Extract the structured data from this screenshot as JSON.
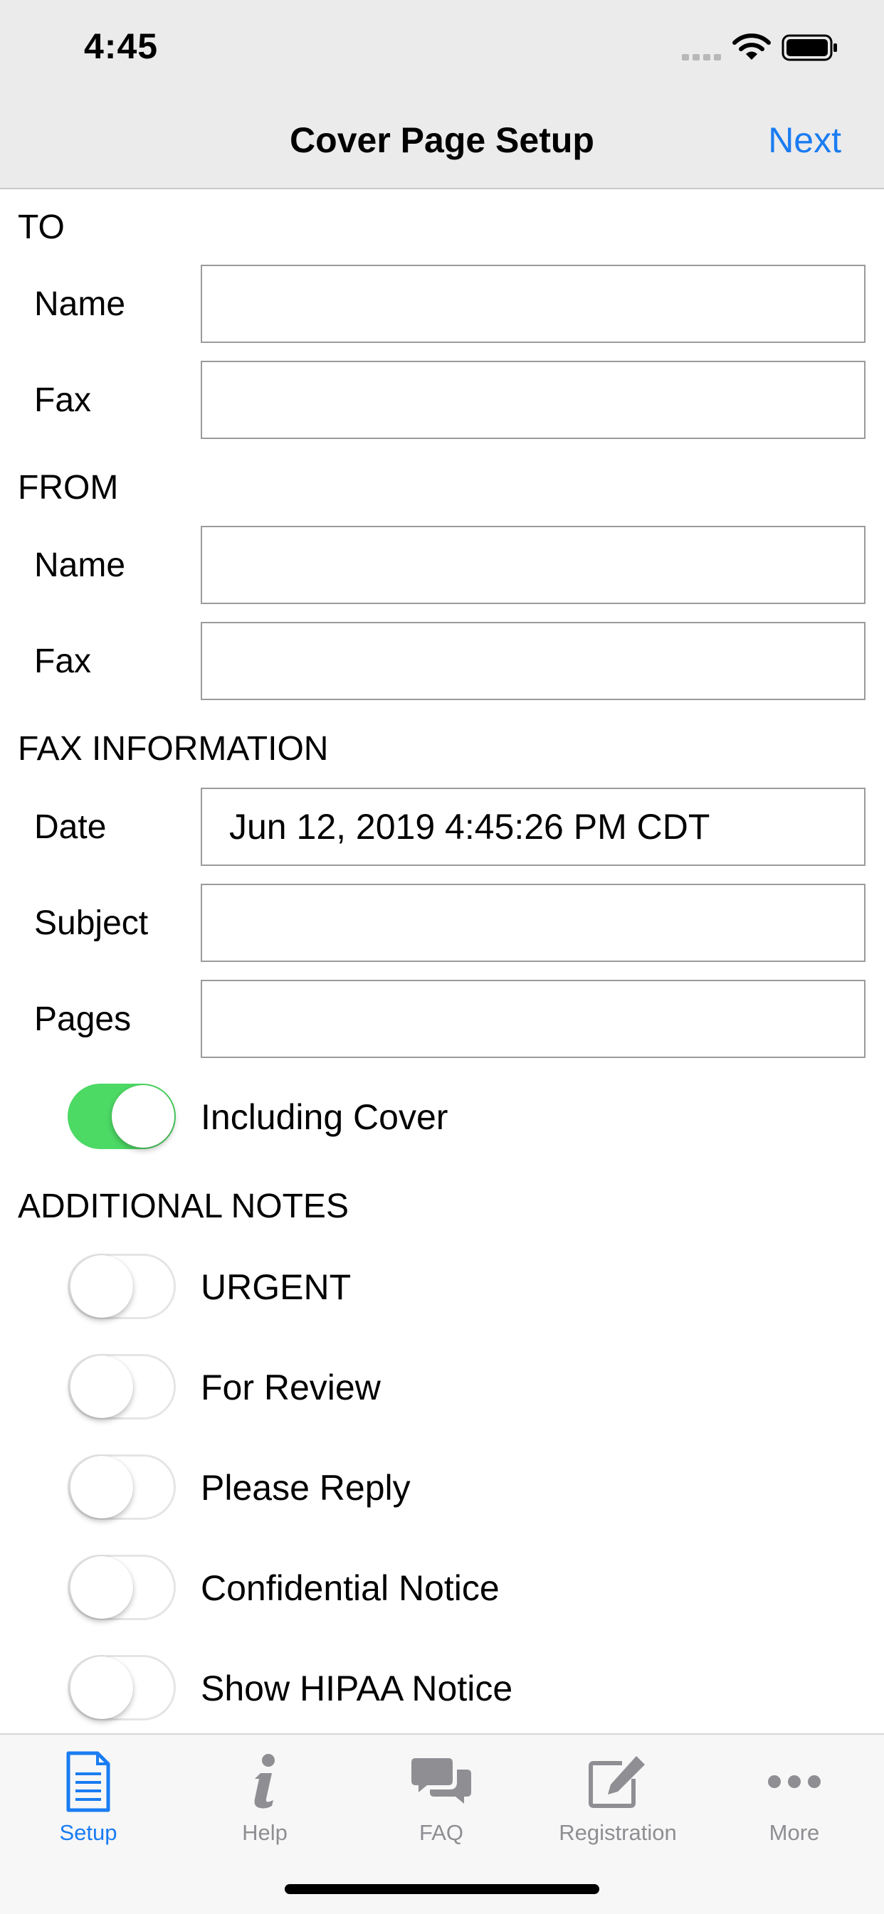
{
  "status_bar": {
    "time": "4:45"
  },
  "nav": {
    "title": "Cover Page Setup",
    "next_label": "Next"
  },
  "to": {
    "header": "TO",
    "name_label": "Name",
    "name_value": "",
    "fax_label": "Fax",
    "fax_value": ""
  },
  "from": {
    "header": "FROM",
    "name_label": "Name",
    "name_value": "",
    "fax_label": "Fax",
    "fax_value": ""
  },
  "fax_info": {
    "header": "FAX INFORMATION",
    "date_label": "Date",
    "date_value": "Jun 12, 2019 4:45:26 PM CDT",
    "subject_label": "Subject",
    "subject_value": "",
    "pages_label": "Pages",
    "pages_value": "",
    "including_cover_label": "Including Cover",
    "including_cover_on": true
  },
  "notes": {
    "header": "ADDITIONAL NOTES",
    "items": [
      {
        "label": "URGENT",
        "on": false
      },
      {
        "label": "For Review",
        "on": false
      },
      {
        "label": "Please Reply",
        "on": false
      },
      {
        "label": "Confidential Notice",
        "on": false
      },
      {
        "label": "Show HIPAA Notice",
        "on": false
      }
    ]
  },
  "tabs": [
    {
      "label": "Setup",
      "icon": "document-icon",
      "active": true
    },
    {
      "label": "Help",
      "icon": "info-icon",
      "active": false
    },
    {
      "label": "FAQ",
      "icon": "chat-bubbles-icon",
      "active": false
    },
    {
      "label": "Registration",
      "icon": "edit-icon",
      "active": false
    },
    {
      "label": "More",
      "icon": "ellipsis-icon",
      "active": false
    }
  ],
  "colors": {
    "accent": "#1a7cf2",
    "toggle_on": "#4cd964",
    "inactive": "#8e8e93"
  }
}
